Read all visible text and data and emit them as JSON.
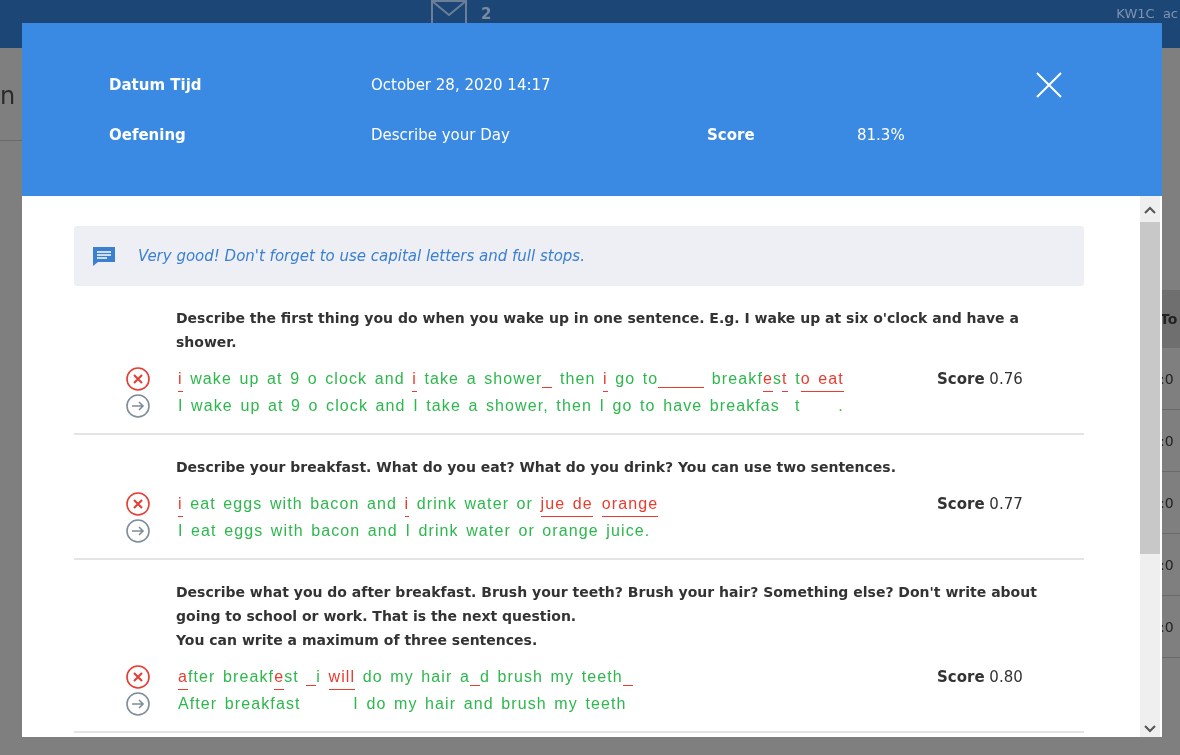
{
  "background": {
    "nav": {
      "mail_count": "2",
      "user": "KW1C",
      "user_more": "ac"
    },
    "left_fragments": [
      {
        "text": "n",
        "kind": "title"
      }
    ],
    "table": {
      "header": "To",
      "cells": [
        ":0",
        ":0",
        ":0",
        ":0",
        ":0"
      ]
    }
  },
  "modal": {
    "header": {
      "fields": [
        {
          "label": "Datum Tijd",
          "value": "October 28, 2020 14:17"
        },
        {
          "label": "Oefening",
          "value": "Describe your Day"
        }
      ],
      "score_label": "Score",
      "score_value": "81.3%"
    },
    "feedback": "Very good! Don't forget to use capital letters and full stops.",
    "questions": [
      {
        "prompt": "Describe the first thing you do when you wake up in one sentence. E.g. I wake up at six o'clock and have a shower.",
        "score_label": "Score",
        "score": "0.76",
        "answer": [
          {
            "kind": "wrong",
            "text": "i"
          },
          {
            "kind": "ok",
            "text": " wake up at 9 o clock and "
          },
          {
            "kind": "wrong",
            "text": "i"
          },
          {
            "kind": "ok",
            "text": " take a shower"
          },
          {
            "kind": "gap"
          },
          {
            "kind": "ok",
            "text": " then "
          },
          {
            "kind": "wrong",
            "text": "i"
          },
          {
            "kind": "ok",
            "text": " go to"
          },
          {
            "kind": "gap",
            "wide": true
          },
          {
            "kind": "ok",
            "text": " breakf"
          },
          {
            "kind": "wrong",
            "text": "e"
          },
          {
            "kind": "ok",
            "text": "s"
          },
          {
            "kind": "wrong",
            "text": "t"
          },
          {
            "kind": "ok",
            "text": " t"
          },
          {
            "kind": "wrong",
            "text": "o eat"
          }
        ],
        "correction": "I wake up at 9 o clock and I take a shower, then I go to have breakfas  t     ."
      },
      {
        "prompt": "Describe your breakfast. What do you eat? What do you drink? You can use two sentences.",
        "score_label": "Score",
        "score": "0.77",
        "answer": [
          {
            "kind": "wrong",
            "text": "i"
          },
          {
            "kind": "ok",
            "text": " eat eggs with bacon and "
          },
          {
            "kind": "wrong",
            "text": "i"
          },
          {
            "kind": "ok",
            "text": " drink water or "
          },
          {
            "kind": "wrong",
            "text": "jue de"
          },
          {
            "kind": "space"
          },
          {
            "kind": "wrong",
            "text": "orange"
          }
        ],
        "correction": "I eat eggs with bacon and I drink water or orange juice."
      },
      {
        "prompt": "Describe what you do after breakfast. Brush your teeth? Brush your hair? Something else? Don't write about going to school or work. That is the next question.\nYou can write a maximum of three sentences.",
        "score_label": "Score",
        "score": "0.80",
        "answer": [
          {
            "kind": "wrong",
            "text": "a"
          },
          {
            "kind": "ok",
            "text": "fter breakf"
          },
          {
            "kind": "wrong",
            "text": "e"
          },
          {
            "kind": "ok",
            "text": "st "
          },
          {
            "kind": "gap"
          },
          {
            "kind": "ok",
            "text": "i "
          },
          {
            "kind": "wrong",
            "text": "will"
          },
          {
            "kind": "ok",
            "text": " do my hair a"
          },
          {
            "kind": "gap"
          },
          {
            "kind": "ok",
            "text": "d brush my teeth"
          },
          {
            "kind": "gap"
          }
        ],
        "correction": "After breakfast       I do my hair and brush my teeth"
      }
    ]
  }
}
